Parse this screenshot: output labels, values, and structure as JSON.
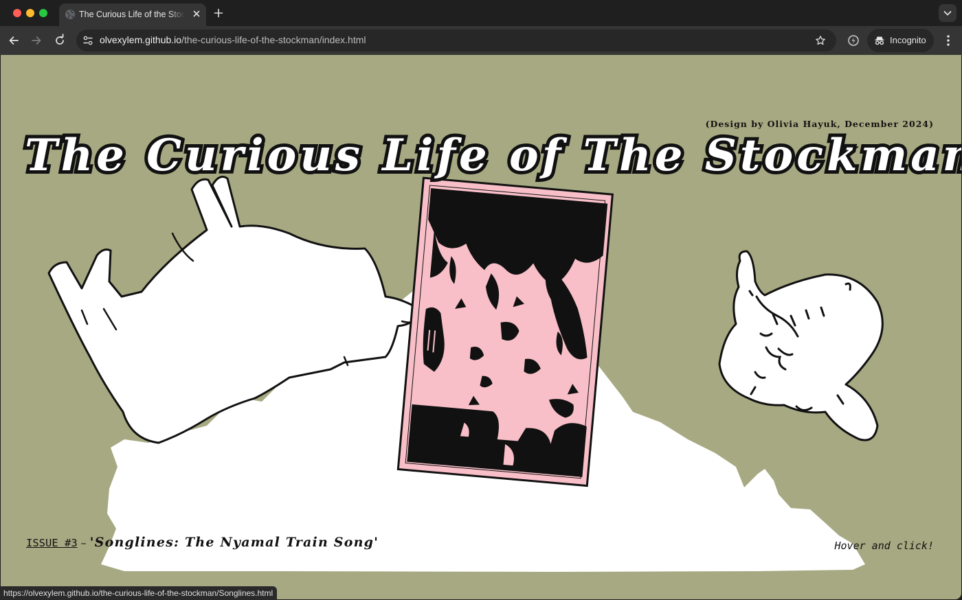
{
  "browser": {
    "tab": {
      "title": "The Curious Life of the Stockman"
    },
    "url": {
      "host": "olvexylem.github.io",
      "path": "/the-curious-life-of-the-stockman/index.html"
    },
    "profile_label": "Incognito",
    "status_url": "https://olvexylem.github.io/the-curious-life-of-the-stockman/Songlines.html"
  },
  "page": {
    "credit": "(Design by Olivia Hayuk, December 2024)",
    "title": "The Curious Life of The Stockman",
    "issue": {
      "label": "ISSUE #3",
      "separator": "–",
      "name": "'Songlines: The Nyamal Train Song'"
    },
    "hint_prefix": "Hover and ",
    "hint_action": "click!"
  },
  "colors": {
    "page_background": "#a7a982",
    "photo_pink": "#f8bfc8",
    "ink": "#111111",
    "cutout_white": "#ffffff"
  }
}
